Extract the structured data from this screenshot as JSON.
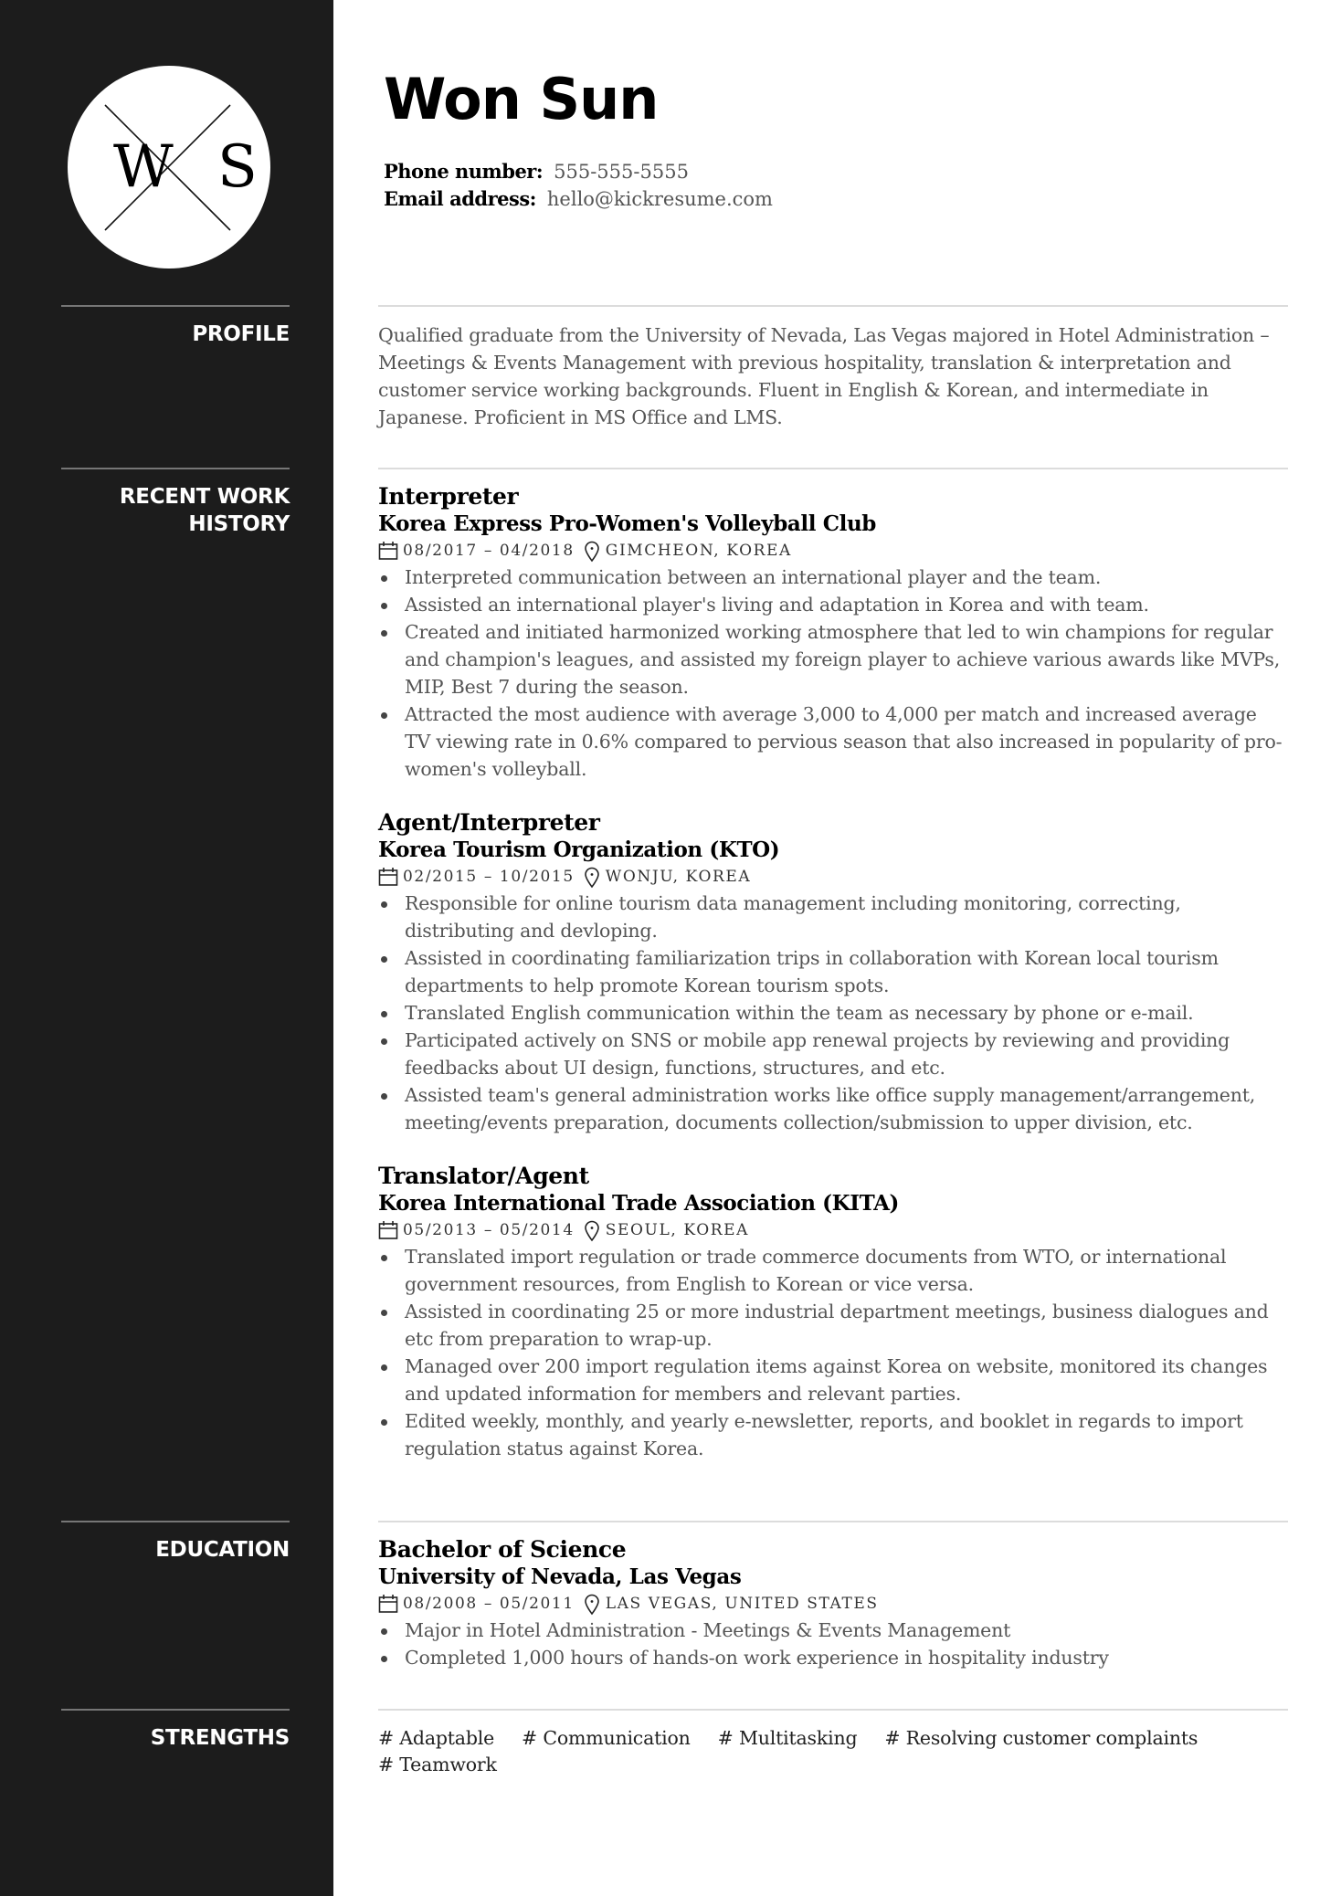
{
  "header": {
    "monogram": {
      "left": "W",
      "right": "S"
    },
    "name": "Won Sun",
    "phone_label": "Phone number:",
    "phone": "555-555-5555",
    "email_label": "Email address:",
    "email": "hello@kickresume.com"
  },
  "profile": {
    "heading": "PROFILE",
    "text": "Qualified graduate from the University of Nevada, Las Vegas majored in Hotel Administration – Meetings & Events Management with previous hospitality, translation & interpretation and customer service working backgrounds. Fluent in English & Korean, and intermediate in Japanese. Proficient in MS Office and LMS."
  },
  "work": {
    "heading_line1": "RECENT WORK",
    "heading_line2": "HISTORY",
    "jobs": [
      {
        "title": "Interpreter",
        "organization": "Korea Express Pro-Women's Volleyball Club",
        "dates": "08/2017 – 04/2018",
        "location": "GIMCHEON, KOREA",
        "bullets": [
          "Interpreted communication between an international player and the team.",
          "Assisted an international player's living and adaptation in Korea and with team.",
          "Created and initiated harmonized working atmosphere that led to win champions for regular and champion's leagues, and assisted my foreign player to achieve various awards like MVPs, MIP, Best 7 during the season.",
          "Attracted the most audience with average 3,000 to 4,000 per match and increased average TV viewing rate in 0.6% compared to pervious season that also increased in popularity of pro-women's volleyball."
        ]
      },
      {
        "title": "Agent/Interpreter",
        "organization": "Korea Tourism Organization (KTO)",
        "dates": "02/2015 – 10/2015",
        "location": "WONJU, KOREA",
        "bullets": [
          "Responsible for online tourism data management including monitoring, correcting, distributing and devloping.",
          "Assisted in coordinating familiarization trips in collaboration with Korean local tourism departments to help promote Korean tourism spots.",
          "Translated English communication within the team as necessary by phone or e-mail.",
          "Participated actively on SNS or mobile app renewal projects by reviewing and providing feedbacks about UI design, functions, structures, and etc.",
          "Assisted team's general administration works like office supply management/arrangement, meeting/events preparation, documents collection/submission to upper division, etc."
        ]
      },
      {
        "title": "Translator/Agent",
        "organization": "Korea International Trade Association (KITA)",
        "dates": "05/2013 – 05/2014",
        "location": "SEOUL, KOREA",
        "bullets": [
          "Translated import regulation or trade commerce documents from WTO, or international government resources, from English to Korean or vice versa.",
          "Assisted in coordinating 25 or more industrial department meetings, business dialogues and etc from preparation to wrap-up.",
          "Managed over 200 import regulation items against Korea on website, monitored its changes and updated information for members and relevant parties.",
          "Edited weekly, monthly, and yearly e-newsletter, reports, and booklet in regards to import regulation status against Korea."
        ]
      }
    ]
  },
  "education": {
    "heading": "EDUCATION",
    "degree": "Bachelor of Science",
    "school": "University of Nevada, Las Vegas",
    "dates": "08/2008 – 05/2011",
    "location": "LAS VEGAS, UNITED STATES",
    "bullets": [
      "Major in Hotel Administration - Meetings & Events Management",
      "Completed 1,000 hours of hands-on work experience in hospitality industry"
    ]
  },
  "strengths": {
    "heading": "STRENGTHS",
    "items": [
      "# Adaptable",
      "# Communication",
      "# Multitasking",
      "# Resolving customer complaints",
      "# Teamwork"
    ]
  },
  "icons": {
    "date": "calendar-icon",
    "location": "map-pin-icon"
  },
  "colors": {
    "sidebar": "#1c1c1c",
    "sidebar_rule": "#767676",
    "main_rule": "#dcdcdc",
    "body_text": "#555555",
    "heading_text": "#000000"
  }
}
